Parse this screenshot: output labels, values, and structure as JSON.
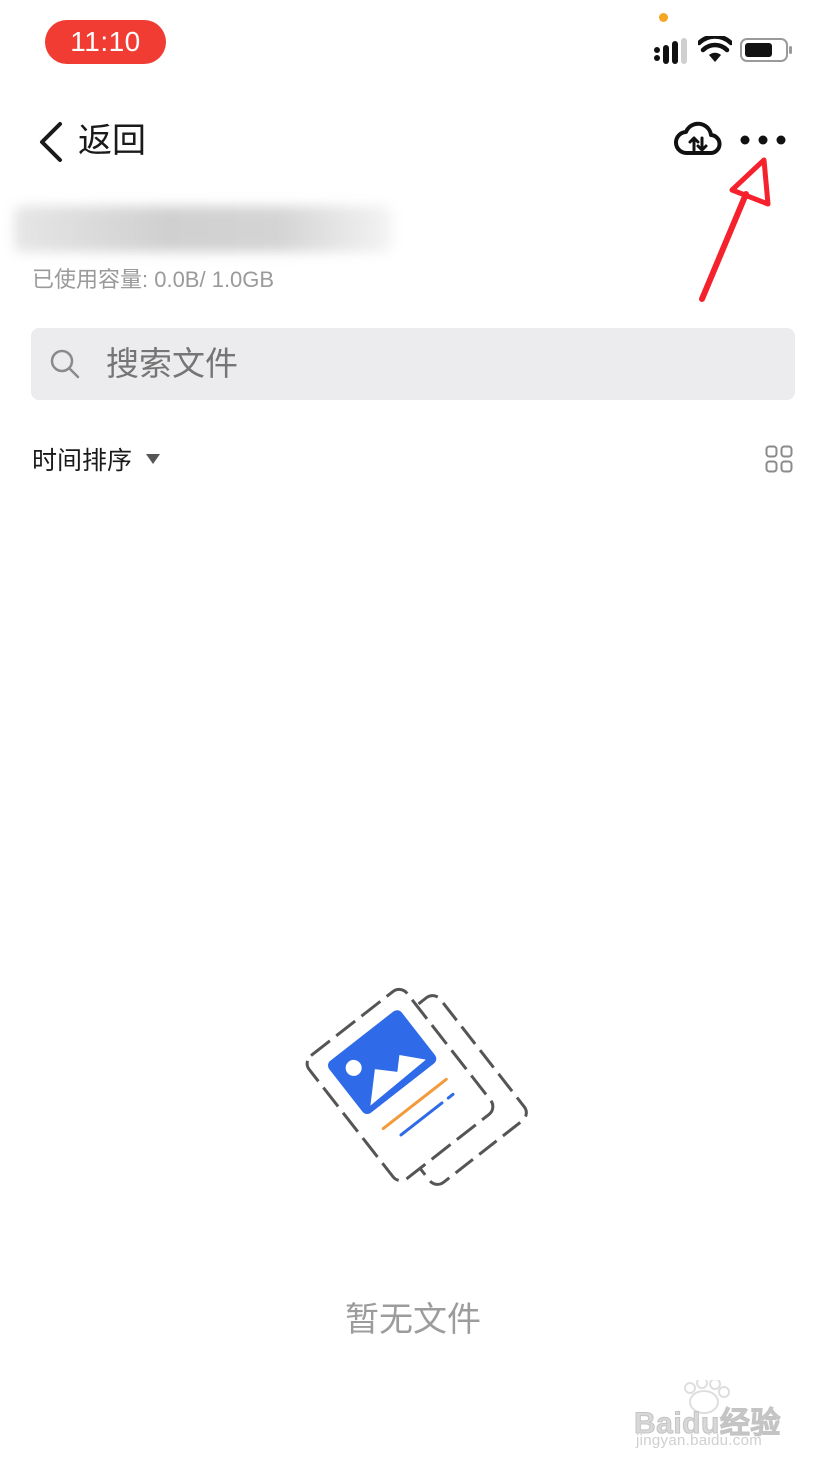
{
  "status_bar": {
    "time": "11:10"
  },
  "nav": {
    "back_label": "返回"
  },
  "storage": {
    "usage_text": "已使用容量: 0.0B/ 1.0GB"
  },
  "search": {
    "placeholder": "搜索文件"
  },
  "sort": {
    "label": "时间排序"
  },
  "empty_state": {
    "text": "暂无文件"
  },
  "watermark": {
    "brand": "Baidu经验",
    "url": "jingyan.baidu.com"
  },
  "colors": {
    "time_pill": "#f03c32",
    "accent_blue": "#2f6be8",
    "accent_orange": "#f39a3a",
    "annotation_arrow": "#f5222d"
  },
  "icons": [
    "signal-icon",
    "wifi-icon",
    "battery-icon",
    "back-chevron-icon",
    "cloud-transfer-icon",
    "more-icon",
    "search-icon",
    "caret-down-icon",
    "grid-view-icon",
    "empty-files-illustration"
  ]
}
